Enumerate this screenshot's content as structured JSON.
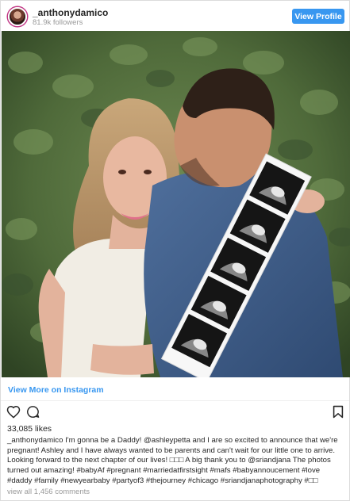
{
  "header": {
    "username": "_anthonydamico",
    "followers": "81.9k followers",
    "view_profile_label": "View Profile"
  },
  "post": {
    "image_alt": "Couple holding ultrasound photo strip in front of ivy wall",
    "view_more_label": "View More on Instagram",
    "likes": "33,085 likes",
    "caption_user": "_anthonydamico",
    "caption_text": "I'm gonna be a Daddy! @ashleypetta and I are so excited to announce that we're pregnant! Ashley and I have always wanted to be parents and can't wait for our little one to arrive. Looking forward to the next chapter of our lives! □□□ A big thank you to @sriandjana The photos turned out amazing! #babyAf #pregnant #marriedatfirstsight #mafs #babyannoucement #love #daddy #family #newyearbaby #partyof3 #thejourney #chicago #sriandjanaphotography #□□",
    "comments_link": "view all 1,456 comments"
  },
  "icons": {
    "like": "heart-icon",
    "comment": "comment-icon",
    "save": "bookmark-icon"
  },
  "colors": {
    "accent": "#3897f0",
    "muted": "#999999",
    "text": "#262626",
    "border": "#dbdbdb"
  }
}
